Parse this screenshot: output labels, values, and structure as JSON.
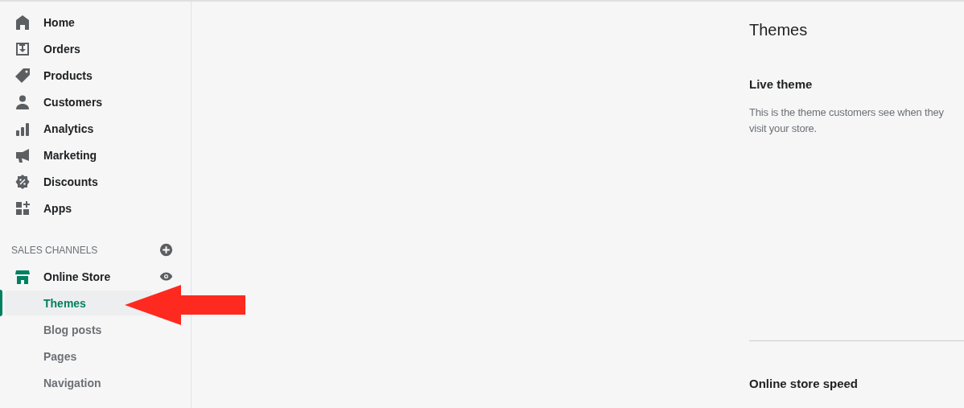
{
  "sidebar": {
    "items": [
      {
        "label": "Home"
      },
      {
        "label": "Orders"
      },
      {
        "label": "Products"
      },
      {
        "label": "Customers"
      },
      {
        "label": "Analytics"
      },
      {
        "label": "Marketing"
      },
      {
        "label": "Discounts"
      },
      {
        "label": "Apps"
      }
    ],
    "sales_channels": {
      "heading": "SALES CHANNELS",
      "channel": {
        "label": "Online Store",
        "children": [
          {
            "label": "Themes",
            "selected": true
          },
          {
            "label": "Blog posts",
            "selected": false
          },
          {
            "label": "Pages",
            "selected": false
          },
          {
            "label": "Navigation",
            "selected": false
          }
        ]
      }
    }
  },
  "main": {
    "title": "Themes",
    "live_theme": {
      "heading": "Live theme",
      "description": "This is the theme customers see when they visit your store."
    },
    "speed": {
      "heading": "Online store speed"
    }
  }
}
